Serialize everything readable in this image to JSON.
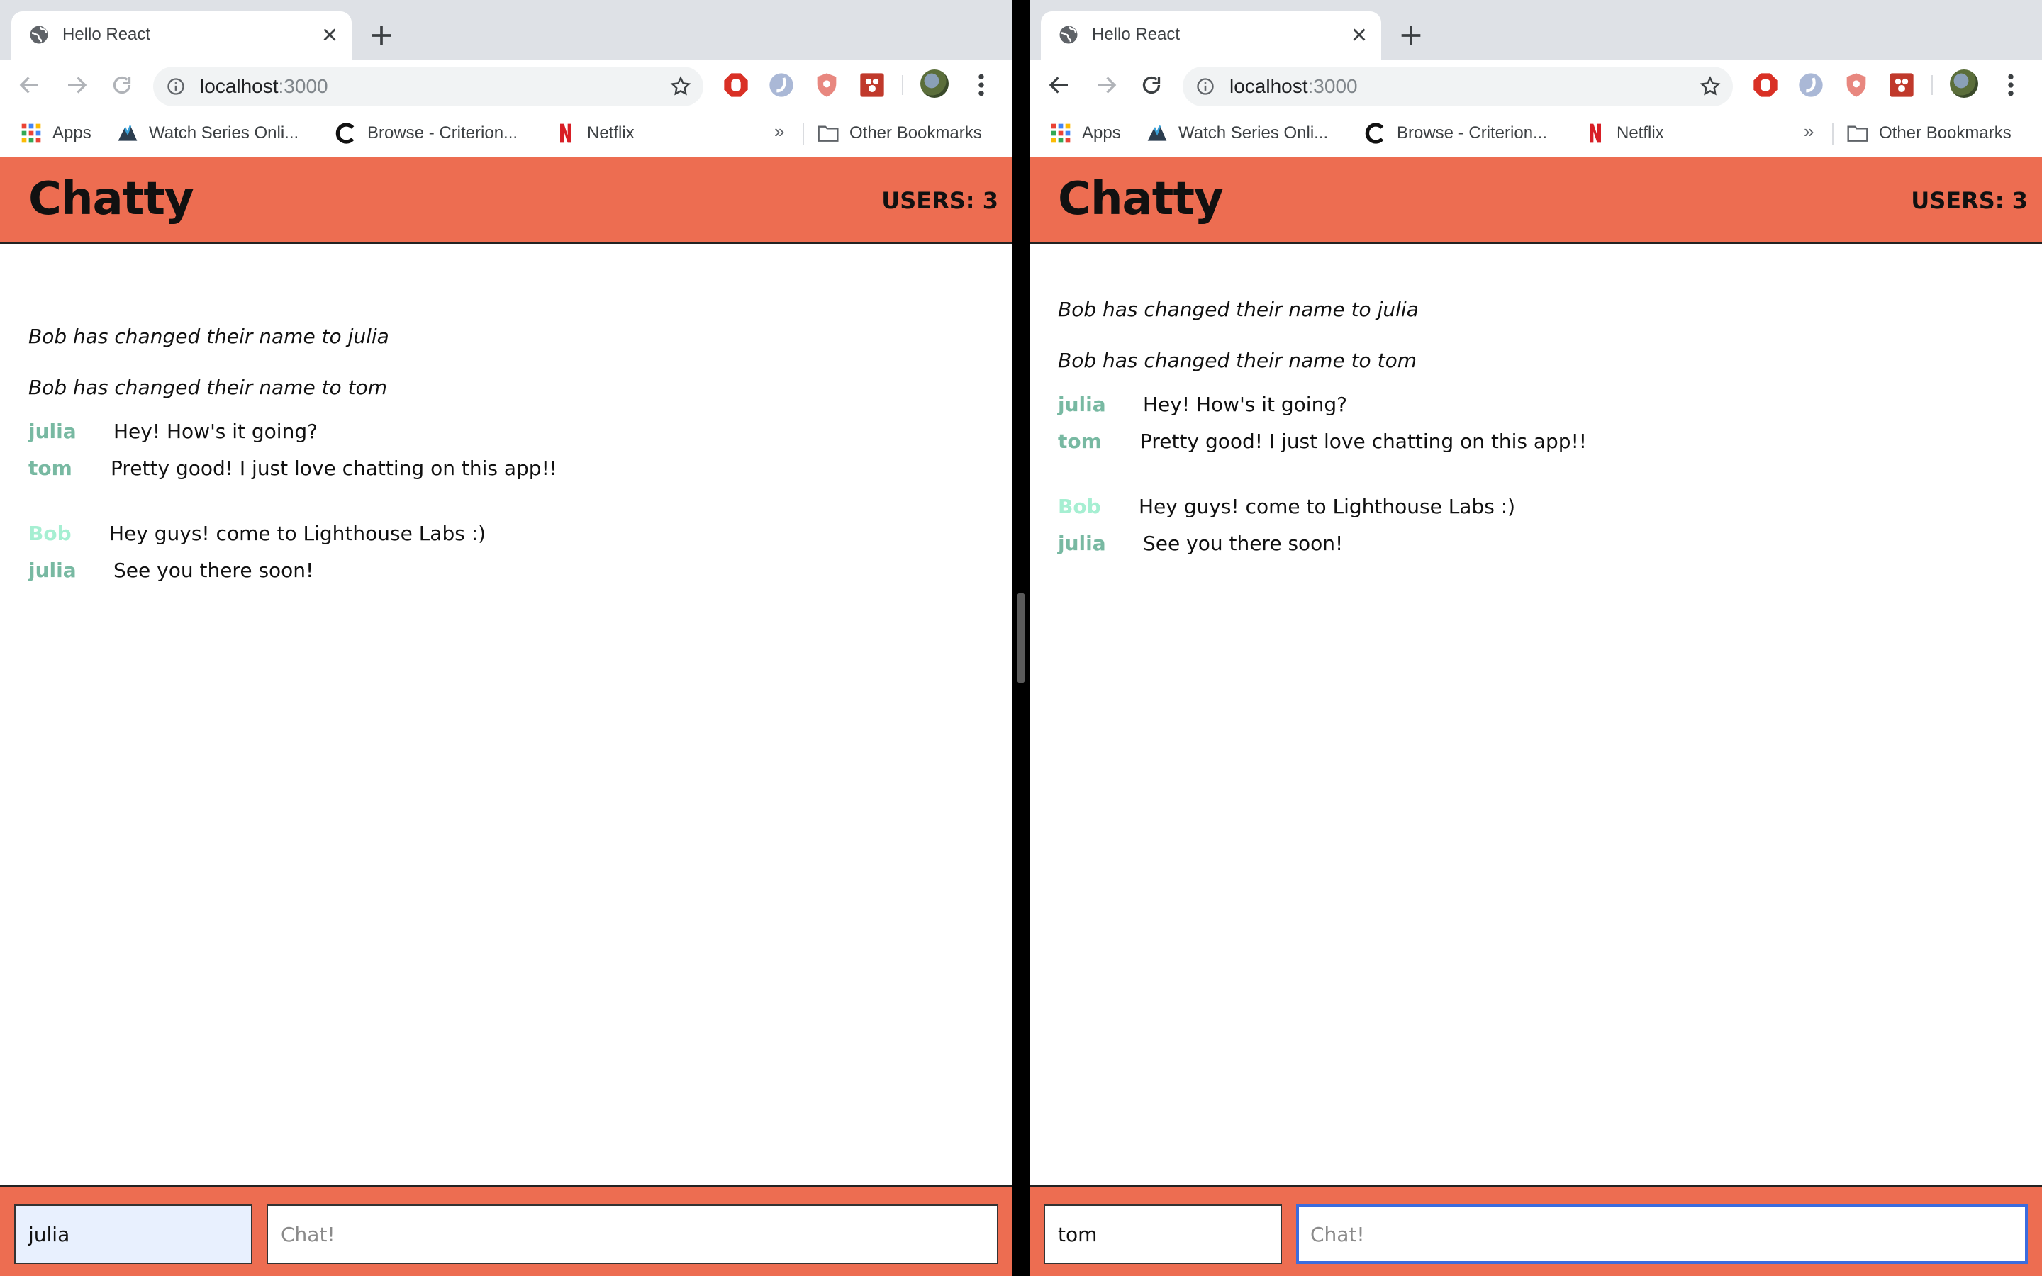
{
  "windows": [
    {
      "tab_title": "Hello React",
      "url_host": "localhost",
      "url_port": ":3000",
      "bookmarks": [
        {
          "label": "Apps",
          "icon": "apps-grid-icon"
        },
        {
          "label": "Watch Series Onli...",
          "icon": "watch-series-icon"
        },
        {
          "label": "Browse - Criterion...",
          "icon": "criterion-icon"
        },
        {
          "label": "Netflix",
          "icon": "netflix-icon"
        }
      ],
      "bookmarks_overflow": "»",
      "other_bookmarks": "Other Bookmarks",
      "app": {
        "brand": "Chatty",
        "users": "USERS: 3",
        "notifications": [
          "Bob has changed their name to julia",
          "Bob has changed their name to tom"
        ],
        "messages": [
          {
            "user": "julia",
            "content": "Hey! How's it going?"
          },
          {
            "user": "tom",
            "content": "Pretty good! I just love chatting on this app!!"
          },
          {
            "user": "Bob",
            "content": "Hey guys! come to Lighthouse Labs :)"
          },
          {
            "user": "julia",
            "content": "See you there soon!"
          }
        ],
        "name_value": "julia",
        "chat_placeholder": "Chat!"
      }
    },
    {
      "tab_title": "Hello React",
      "url_host": "localhost",
      "url_port": ":3000",
      "bookmarks": [
        {
          "label": "Apps",
          "icon": "apps-grid-icon"
        },
        {
          "label": "Watch Series Onli...",
          "icon": "watch-series-icon"
        },
        {
          "label": "Browse - Criterion...",
          "icon": "criterion-icon"
        },
        {
          "label": "Netflix",
          "icon": "netflix-icon"
        }
      ],
      "bookmarks_overflow": "»",
      "other_bookmarks": "Other Bookmarks",
      "app": {
        "brand": "Chatty",
        "users": "USERS: 3",
        "notifications": [
          "Bob has changed their name to julia",
          "Bob has changed their name to tom"
        ],
        "messages": [
          {
            "user": "julia",
            "content": "Hey! How's it going?"
          },
          {
            "user": "tom",
            "content": "Pretty good! I just love chatting on this app!!"
          },
          {
            "user": "Bob",
            "content": "Hey guys! come to Lighthouse Labs :)"
          },
          {
            "user": "julia",
            "content": "See you there soon!"
          }
        ],
        "name_value": "tom",
        "chat_placeholder": "Chat!"
      }
    }
  ],
  "colors": {
    "brand_orange": "#ed6d51",
    "username_teal": "#78b9a2",
    "username_bob": "#a6efd2",
    "focus_blue": "#3b6cde"
  }
}
